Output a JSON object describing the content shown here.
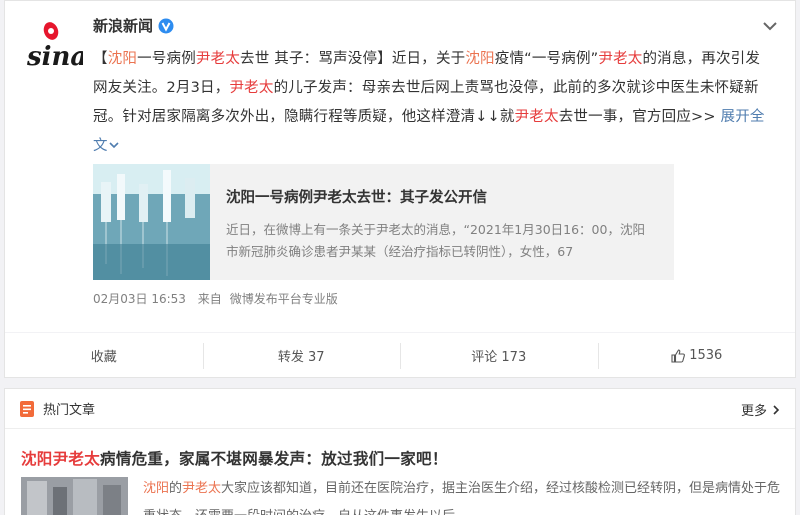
{
  "post": {
    "user_name": "新浪新闻",
    "text": {
      "p1": "【",
      "p2": "沈阳",
      "p3": "一号病例",
      "p4": "尹老太",
      "p5": "去世 其子：骂声没停】近日，关于",
      "p6": "沈阳",
      "p7": "疫情“一号病例”",
      "p8": "尹老太",
      "p9": "的消息，再次引发网友关注。2月3日，",
      "p10": "尹老太",
      "p11": "的儿子发声：母亲去世后网上责骂也没停，此前的多次就诊中医生未怀疑新冠。针对居家隔离多次外出，隐瞒行程等质疑，他这样澄清↓↓就",
      "p12": "尹老太",
      "p13": "去世一事，官方回应>> ",
      "expand": "展开全文"
    },
    "article": {
      "title": "沈阳一号病例尹老太去世：其子发公开信",
      "desc": "近日，在微博上有一条关于尹老太的消息，“2021年1月30日16：00，沈阳市新冠肺炎确诊患者尹某某（经治疗指标已转阴性），女性，67"
    },
    "meta": {
      "time": "02月03日 16:53",
      "from_label": "来自",
      "source": "微博发布平台专业版"
    },
    "actions": {
      "favorite": "收藏",
      "repost": "转发 37",
      "comment": "评论 173",
      "like": "1536"
    }
  },
  "hot": {
    "title": "热门文章",
    "more": "更多",
    "headline": {
      "h1": "沈阳尹老太",
      "h2": "病情危重，家属不堪网暴发声：放过我们一家吧！"
    },
    "snippet": {
      "s1": "沈阳",
      "s2": "的",
      "s3": "尹老太",
      "s4": "大家应该都知道，目前还在医院治疗，据主治医生介绍，经过核酸检测已经转阴，但是病情处于危重状态，还需要一段时间的治疗。自从这件事发生以后"
    }
  },
  "colors": {
    "highlight": "#eb7350",
    "headline_red": "#e63c3c",
    "link_blue": "#507daf"
  },
  "icons": [
    "sina-logo",
    "verified-icon",
    "chevron-down-icon",
    "like-icon",
    "document-icon",
    "chevron-right-icon"
  ]
}
